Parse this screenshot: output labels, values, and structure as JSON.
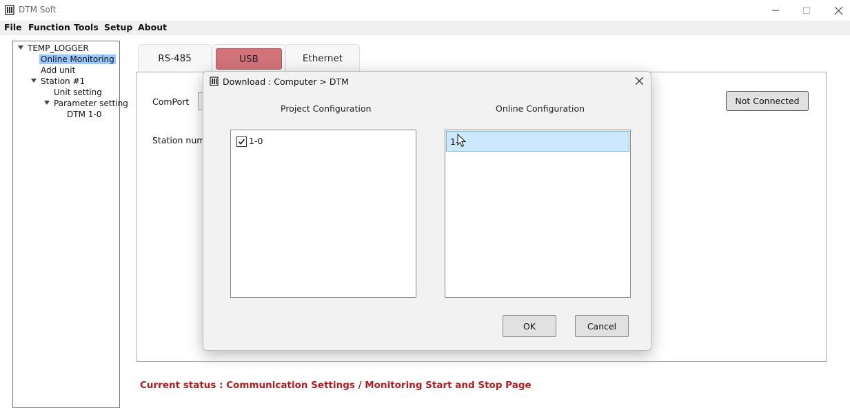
{
  "window": {
    "title": "DTM Soft"
  },
  "menu": {
    "items": [
      "File",
      "Function",
      "Tools",
      "Setup",
      "About"
    ]
  },
  "tree": {
    "root": "TEMP_LOGGER",
    "online_monitoring": "Online Monitoring",
    "add_unit": "Add unit",
    "station": "Station #1",
    "unit_setting": "Unit setting",
    "parameter_setting": "Parameter setting",
    "dtm": "DTM 1-0"
  },
  "tabs": {
    "rs485": "RS-485",
    "usb": "USB",
    "ethernet": "Ethernet"
  },
  "main": {
    "comport_label": "ComPort",
    "station_label": "Station numbe",
    "connection_button": "Not Connected",
    "status_text": "Current status : Communication Settings / Monitoring Start and Stop Page"
  },
  "dialog": {
    "title": "Download : Computer > DTM",
    "project_heading": "Project Configuration",
    "online_heading": "Online Configuration",
    "project_items": [
      "1-0"
    ],
    "online_items": [
      "1-"
    ],
    "ok_label": "OK",
    "cancel_label": "Cancel"
  },
  "colors": {
    "usb_tab": "#d2727a",
    "selection": "#cce8ff",
    "status_text": "#b01e22",
    "tree_selection": "#99c9ff"
  }
}
